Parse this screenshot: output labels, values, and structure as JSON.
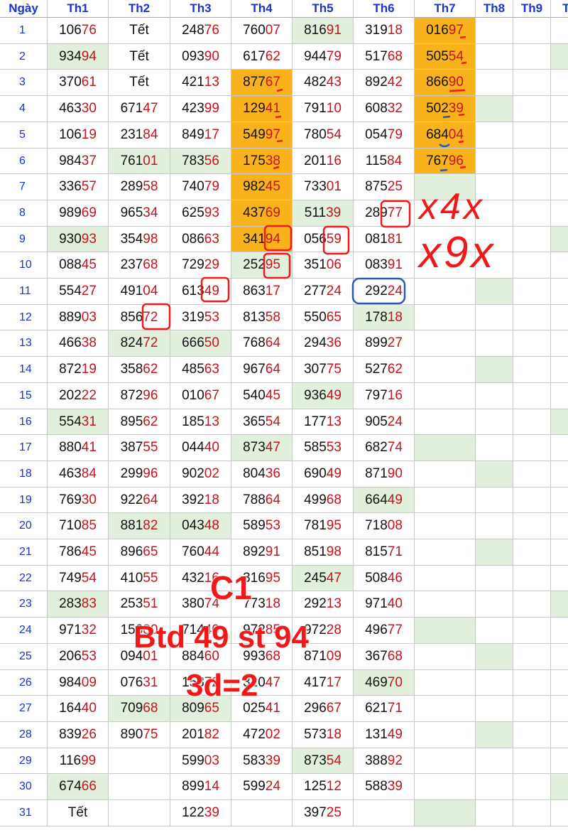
{
  "header": {
    "day_label": "Ngày",
    "columns": [
      "Th1",
      "Th2",
      "Th3",
      "Th4",
      "Th5",
      "Th6",
      "Th7",
      "Th8",
      "Th9",
      "Th"
    ]
  },
  "rows": [
    {
      "day": "1",
      "cells": [
        "10676",
        "Tết",
        "24876",
        "76007",
        "81691",
        "31918",
        "01697",
        "",
        "",
        ""
      ]
    },
    {
      "day": "2",
      "cells": [
        "93494",
        "Tết",
        "09390",
        "61762",
        "94479",
        "51768",
        "50554",
        "",
        "",
        ""
      ]
    },
    {
      "day": "3",
      "cells": [
        "37061",
        "Tết",
        "42113",
        "87767",
        "48243",
        "89242",
        "86690",
        "",
        "",
        ""
      ]
    },
    {
      "day": "4",
      "cells": [
        "46330",
        "67147",
        "42399",
        "12941",
        "79110",
        "60832",
        "50239",
        "",
        "",
        ""
      ]
    },
    {
      "day": "5",
      "cells": [
        "10619",
        "23184",
        "84917",
        "54997",
        "78054",
        "05479",
        "68404",
        "",
        "",
        ""
      ]
    },
    {
      "day": "6",
      "cells": [
        "98437",
        "76101",
        "78356",
        "17538",
        "20116",
        "11584",
        "76796",
        "",
        "",
        ""
      ]
    },
    {
      "day": "7",
      "cells": [
        "33657",
        "28958",
        "74079",
        "98245",
        "73301",
        "87525",
        "",
        "",
        "",
        ""
      ]
    },
    {
      "day": "8",
      "cells": [
        "98969",
        "96534",
        "62593",
        "43769",
        "51139",
        "28977",
        "",
        "",
        "",
        ""
      ]
    },
    {
      "day": "9",
      "cells": [
        "93093",
        "35498",
        "08663",
        "34194",
        "05659",
        "08181",
        "",
        "",
        "",
        ""
      ]
    },
    {
      "day": "10",
      "cells": [
        "08845",
        "23768",
        "72929",
        "25295",
        "35106",
        "08391",
        "",
        "",
        "",
        ""
      ]
    },
    {
      "day": "11",
      "cells": [
        "55427",
        "49104",
        "61349",
        "86317",
        "27724",
        "29224",
        "",
        "",
        "",
        ""
      ]
    },
    {
      "day": "12",
      "cells": [
        "88903",
        "85672",
        "31953",
        "81358",
        "55065",
        "17818",
        "",
        "",
        "",
        ""
      ]
    },
    {
      "day": "13",
      "cells": [
        "46638",
        "82472",
        "66650",
        "76864",
        "29436",
        "89927",
        "",
        "",
        "",
        ""
      ]
    },
    {
      "day": "14",
      "cells": [
        "87219",
        "35862",
        "48563",
        "96764",
        "30775",
        "52762",
        "",
        "",
        "",
        ""
      ]
    },
    {
      "day": "15",
      "cells": [
        "20222",
        "87296",
        "01067",
        "54045",
        "93649",
        "79716",
        "",
        "",
        "",
        ""
      ]
    },
    {
      "day": "16",
      "cells": [
        "55431",
        "89562",
        "18513",
        "36554",
        "17713",
        "90524",
        "",
        "",
        "",
        ""
      ]
    },
    {
      "day": "17",
      "cells": [
        "88041",
        "38755",
        "04440",
        "87347",
        "58553",
        "68274",
        "",
        "",
        "",
        ""
      ]
    },
    {
      "day": "18",
      "cells": [
        "46384",
        "29996",
        "90202",
        "80436",
        "69049",
        "87190",
        "",
        "",
        "",
        ""
      ]
    },
    {
      "day": "19",
      "cells": [
        "76930",
        "92264",
        "39218",
        "78864",
        "49968",
        "66449",
        "",
        "",
        "",
        ""
      ]
    },
    {
      "day": "20",
      "cells": [
        "71085",
        "88182",
        "04348",
        "58953",
        "78195",
        "71808",
        "",
        "",
        "",
        ""
      ]
    },
    {
      "day": "21",
      "cells": [
        "78645",
        "89665",
        "76044",
        "89291",
        "85198",
        "81571",
        "",
        "",
        "",
        ""
      ]
    },
    {
      "day": "22",
      "cells": [
        "74954",
        "41055",
        "43216",
        "31695",
        "24547",
        "50846",
        "",
        "",
        "",
        ""
      ]
    },
    {
      "day": "23",
      "cells": [
        "28383",
        "25351",
        "38074",
        "77318",
        "29213",
        "97140",
        "",
        "",
        "",
        ""
      ]
    },
    {
      "day": "24",
      "cells": [
        "97132",
        "15680",
        "71440",
        "97285",
        "97228",
        "49677",
        "",
        "",
        "",
        ""
      ]
    },
    {
      "day": "25",
      "cells": [
        "20653",
        "09401",
        "88460",
        "99368",
        "87109",
        "36768",
        "",
        "",
        "",
        ""
      ]
    },
    {
      "day": "26",
      "cells": [
        "98409",
        "07631",
        "15372",
        "32047",
        "41717",
        "46970",
        "",
        "",
        "",
        ""
      ]
    },
    {
      "day": "27",
      "cells": [
        "16440",
        "70968",
        "80965",
        "02541",
        "29667",
        "62171",
        "",
        "",
        "",
        ""
      ]
    },
    {
      "day": "28",
      "cells": [
        "83926",
        "89075",
        "20182",
        "47202",
        "57318",
        "13149",
        "",
        "",
        "",
        ""
      ]
    },
    {
      "day": "29",
      "cells": [
        "11699",
        "",
        "59903",
        "58339",
        "87354",
        "38892",
        "",
        "",
        "",
        ""
      ]
    },
    {
      "day": "30",
      "cells": [
        "67466",
        "",
        "89914",
        "59924",
        "12512",
        "58839",
        "",
        "",
        "",
        ""
      ]
    },
    {
      "day": "31",
      "cells": [
        "Tết",
        "",
        "12239",
        "",
        "39725",
        "",
        "",
        "",
        "",
        ""
      ]
    }
  ],
  "highlights": {
    "green": [
      "1-5",
      "2-1",
      "2-10",
      "4-8",
      "6-2",
      "6-3",
      "7-7",
      "8-5",
      "9-1",
      "9-10",
      "10-4",
      "11-8",
      "12-6",
      "13-2",
      "13-3",
      "14-8",
      "15-5",
      "16-1",
      "16-10",
      "17-4",
      "17-7",
      "18-8",
      "19-6",
      "20-2",
      "20-3",
      "21-8",
      "22-5",
      "23-1",
      "23-10",
      "24-7",
      "25-8",
      "26-6",
      "27-2",
      "27-3",
      "28-8",
      "29-5",
      "30-1",
      "30-10",
      "31-7"
    ],
    "orange": [
      "1-7",
      "2-7",
      "3-4",
      "3-7",
      "4-4",
      "4-7",
      "5-4",
      "5-7",
      "6-4",
      "6-7",
      "7-4",
      "8-4",
      "9-4"
    ]
  },
  "annotations": {
    "note_x4": "x4x",
    "note_x9": "x9x",
    "overlay_line1": "C1",
    "overlay_line2": "Btd 49 st 94",
    "overlay_line3": "3d=2"
  },
  "colors": {
    "highlight_green": "#e1f0dc",
    "highlight_orange": "#f7b21c",
    "header_blue": "#1a33cc",
    "tail_red": "#c4141e",
    "marker_red": "#f01818",
    "marker_blue": "#2a5bb0"
  }
}
